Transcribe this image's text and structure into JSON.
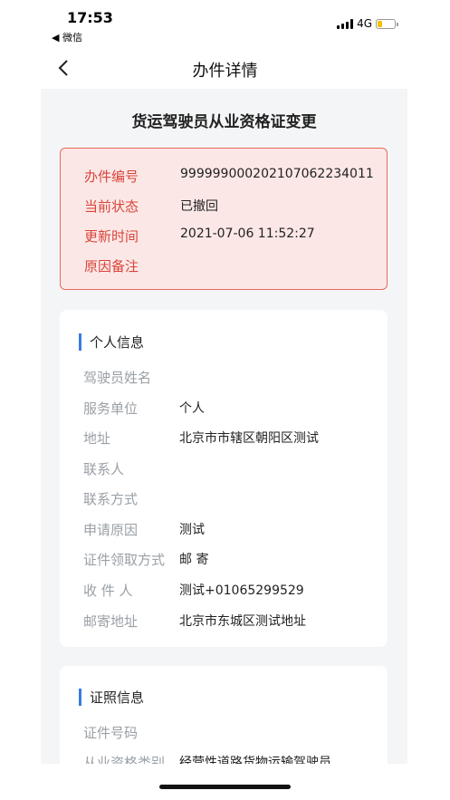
{
  "status_bar": {
    "time": "17:53",
    "back_app": "◀ 微信",
    "network": "4G",
    "battery_fraction": 0.25,
    "battery_color": "#f2c200"
  },
  "nav": {
    "title": "办件详情"
  },
  "form_title": "货运驾驶员从业资格证变更",
  "status": {
    "rows": [
      {
        "label": "办件编号",
        "value": "9999990002021070622340​11"
      },
      {
        "label": "当前状态",
        "value": "已撤回"
      },
      {
        "label": "更新时间",
        "value": "2021-07-06 11:52:27"
      },
      {
        "label": "原因备注",
        "value": ""
      }
    ],
    "accent_color": "#d9443b"
  },
  "personal": {
    "title": "个人信息",
    "fields": [
      {
        "label": "驾驶员姓名",
        "value": ""
      },
      {
        "label": "服务单位",
        "value": "个人"
      },
      {
        "label": "地址",
        "value": "北京市市辖区朝阳区测试"
      },
      {
        "label": "联系人",
        "value": ""
      },
      {
        "label": "联系方式",
        "value": ""
      },
      {
        "label": "申请原因",
        "value": "测试"
      },
      {
        "label": "证件领取方式",
        "value": "邮 寄"
      },
      {
        "label": "收 件 人",
        "value": "测试+01065299529"
      },
      {
        "label": "邮寄地址",
        "value": "北京市东城区测试地址"
      }
    ]
  },
  "license": {
    "title": "证照信息",
    "fields": [
      {
        "label": "证件号码",
        "value": ""
      },
      {
        "label": "从业资格类别",
        "value": "经营性道路货物运输驾驶员"
      }
    ]
  }
}
